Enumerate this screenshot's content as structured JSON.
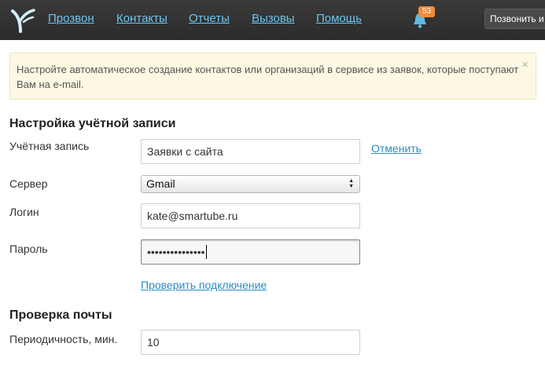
{
  "nav": {
    "items": [
      {
        "label": "Прозвон"
      },
      {
        "label": "Контакты"
      },
      {
        "label": "Отчеты"
      },
      {
        "label": "Вызовы"
      },
      {
        "label": "Помощь"
      }
    ],
    "notification_count": "53",
    "call_button_label": "Позвонить и"
  },
  "notice": {
    "text": "Настройте автоматическое создание контактов или организаций в сервисе из заявок, которые поступают Вам на e-mail.",
    "close": "×"
  },
  "account_section": {
    "title": "Настройка учётной записи",
    "account_label": "Учётная запись",
    "account_value": "Заявки с сайта",
    "cancel_link": "Отменить",
    "server_label": "Сервер",
    "server_value": "Gmail",
    "login_label": "Логин",
    "login_value": "kate@smartube.ru",
    "password_label": "Пароль",
    "password_value": "•••••••••••••••",
    "check_connection_link": "Проверить подключение"
  },
  "mail_section": {
    "title": "Проверка почты",
    "interval_label": "Периодичность, мин.",
    "interval_value": "10"
  },
  "colors": {
    "topbar": "#2f2f2f",
    "nav_link": "#6cc6f0",
    "badge": "#f08b3c",
    "notice_bg": "#fcf8e3",
    "link": "#2b8cc4"
  }
}
